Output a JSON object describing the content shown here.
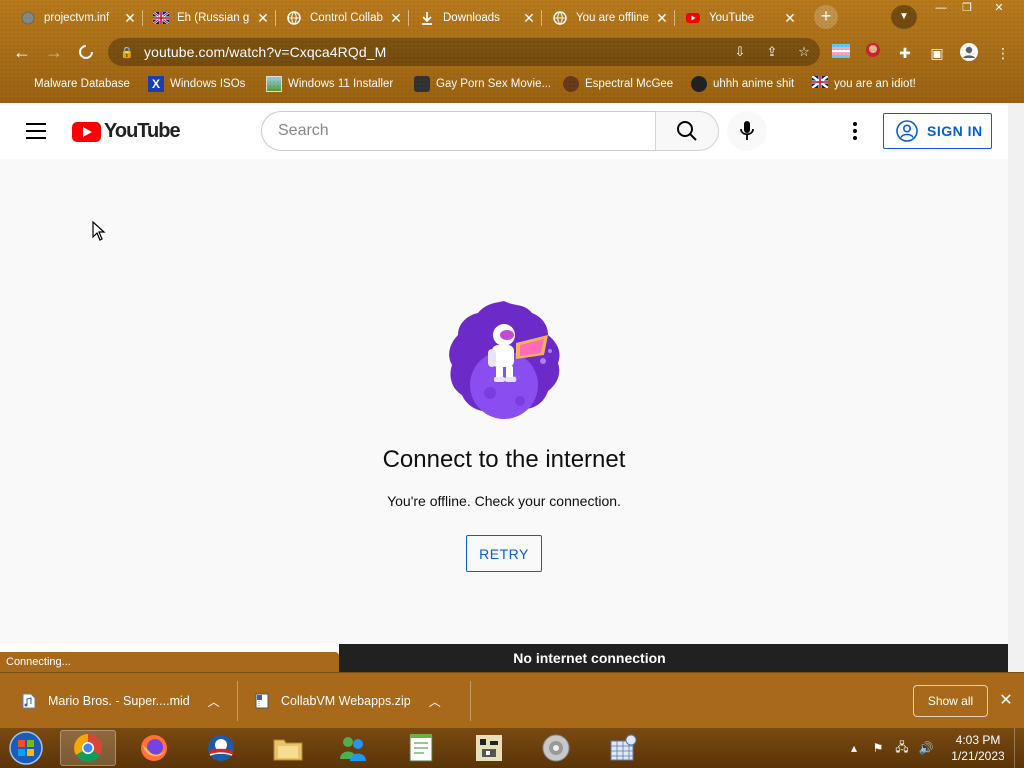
{
  "tabs": [
    {
      "title": "projectvm.inf",
      "icon": "globe-icon"
    },
    {
      "title": "Eh (Russian g",
      "icon": "flag-icon"
    },
    {
      "title": "Control Collab",
      "icon": "globe-icon"
    },
    {
      "title": "Downloads",
      "icon": "download-icon"
    },
    {
      "title": "You are offline",
      "icon": "globe-icon"
    },
    {
      "title": "YouTube",
      "icon": "youtube-icon"
    }
  ],
  "toolbar": {
    "url": "youtube.com/watch?v=Cxqca4RQd_M"
  },
  "bookmarks": [
    {
      "label": "Malware Database"
    },
    {
      "label": "Windows ISOs"
    },
    {
      "label": "Windows 11 Installer"
    },
    {
      "label": "Gay Porn Sex Movie..."
    },
    {
      "label": "Espectral McGee"
    },
    {
      "label": "uhhh anime shit"
    },
    {
      "label": "you are an idiot!"
    }
  ],
  "youtube": {
    "logo_text": "YouTube",
    "search_placeholder": "Search",
    "signin_label": "SIGN IN",
    "offline_title": "Connect to the internet",
    "offline_subtitle": "You're offline. Check your connection.",
    "retry_label": "RETRY"
  },
  "status": {
    "connecting": "Connecting...",
    "no_internet": "No internet connection"
  },
  "downloads": {
    "items": [
      {
        "name": "Mario Bros. - Super....mid"
      },
      {
        "name": "CollabVM Webapps.zip"
      }
    ],
    "show_all": "Show all"
  },
  "taskbar": {
    "time": "4:03 PM",
    "date": "1/21/2023"
  },
  "colors": {
    "theme_brown": "#a8691a",
    "youtube_red": "#ff0000",
    "link_blue": "#065fd4",
    "page_bg": "#f9f9f9"
  }
}
